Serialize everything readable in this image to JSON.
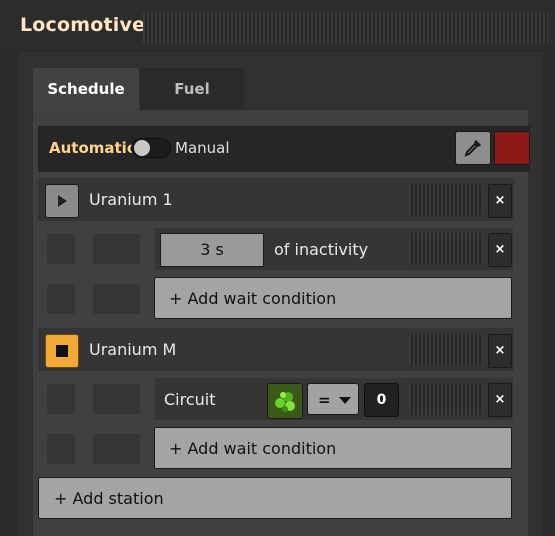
{
  "window": {
    "title": "Locomotive"
  },
  "tabs": [
    {
      "label": "Schedule"
    },
    {
      "label": "Fuel"
    }
  ],
  "mode": {
    "automatic_label": "Automatic",
    "manual_label": "Manual",
    "toggle_state": "automatic"
  },
  "colors": {
    "accent_orange": "#f2a935",
    "train_color": "#8c1a16",
    "title_text": "#ffe6c0",
    "label_orange": "#ffd38a"
  },
  "schedule": {
    "stations": [
      {
        "name": "Uranium 1",
        "status_icon": "play-icon",
        "conditions": [
          {
            "value": "3 s",
            "text": "of inactivity"
          }
        ],
        "add_wait_label": "+ Add wait condition"
      },
      {
        "name": "Uranium M",
        "status_icon": "stop-icon",
        "conditions": [
          {
            "type": "Circuit",
            "signal_icon": "green-ore-signal-icon",
            "comparator": "=",
            "constant": "0"
          }
        ],
        "add_wait_label": "+ Add wait condition"
      }
    ],
    "add_station_label": "+ Add station",
    "remove_symbol": "×"
  }
}
